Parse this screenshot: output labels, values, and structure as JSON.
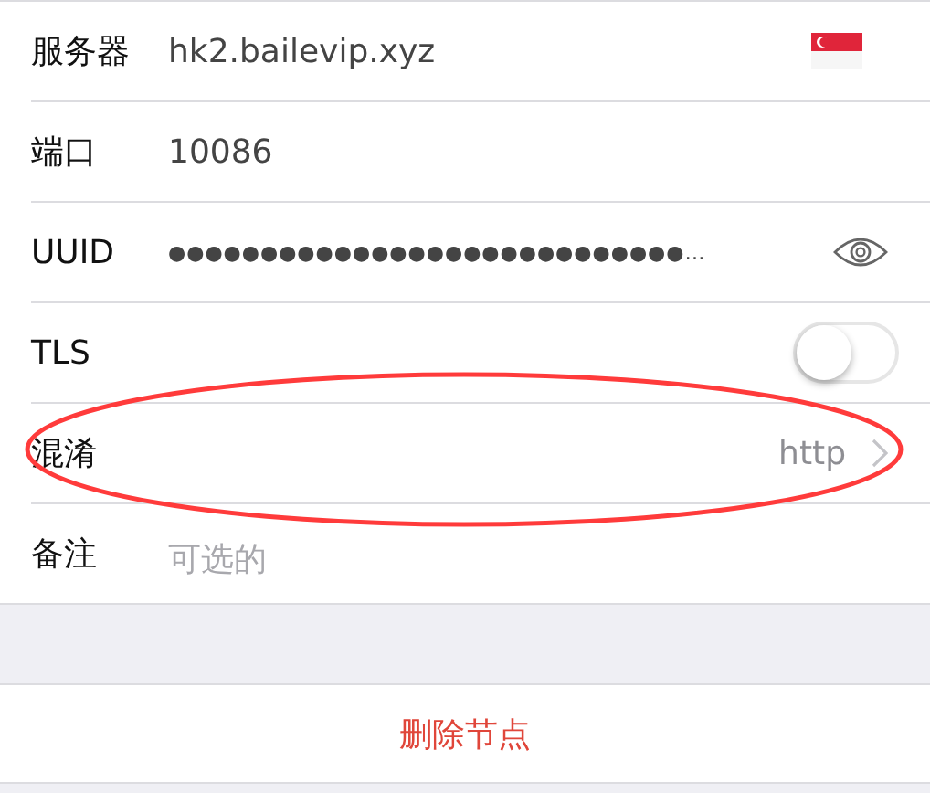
{
  "rows": [
    {
      "kind": "server",
      "label": "服务器",
      "value": "hk2.bailevip.xyz"
    },
    {
      "kind": "text",
      "label": "端口",
      "value": "10086"
    },
    {
      "kind": "secret",
      "label": "UUID",
      "value": "●●●●●●●●●●●●●●●●●●●●●●●●●●●●…"
    },
    {
      "kind": "toggle",
      "label": "TLS",
      "on": false
    },
    {
      "kind": "select",
      "label": "混淆",
      "value": "http"
    },
    {
      "kind": "input",
      "label": "备注",
      "placeholder": "可选的"
    }
  ],
  "annotation": {
    "kind": "ellipse"
  },
  "delete_button": "删除节点"
}
